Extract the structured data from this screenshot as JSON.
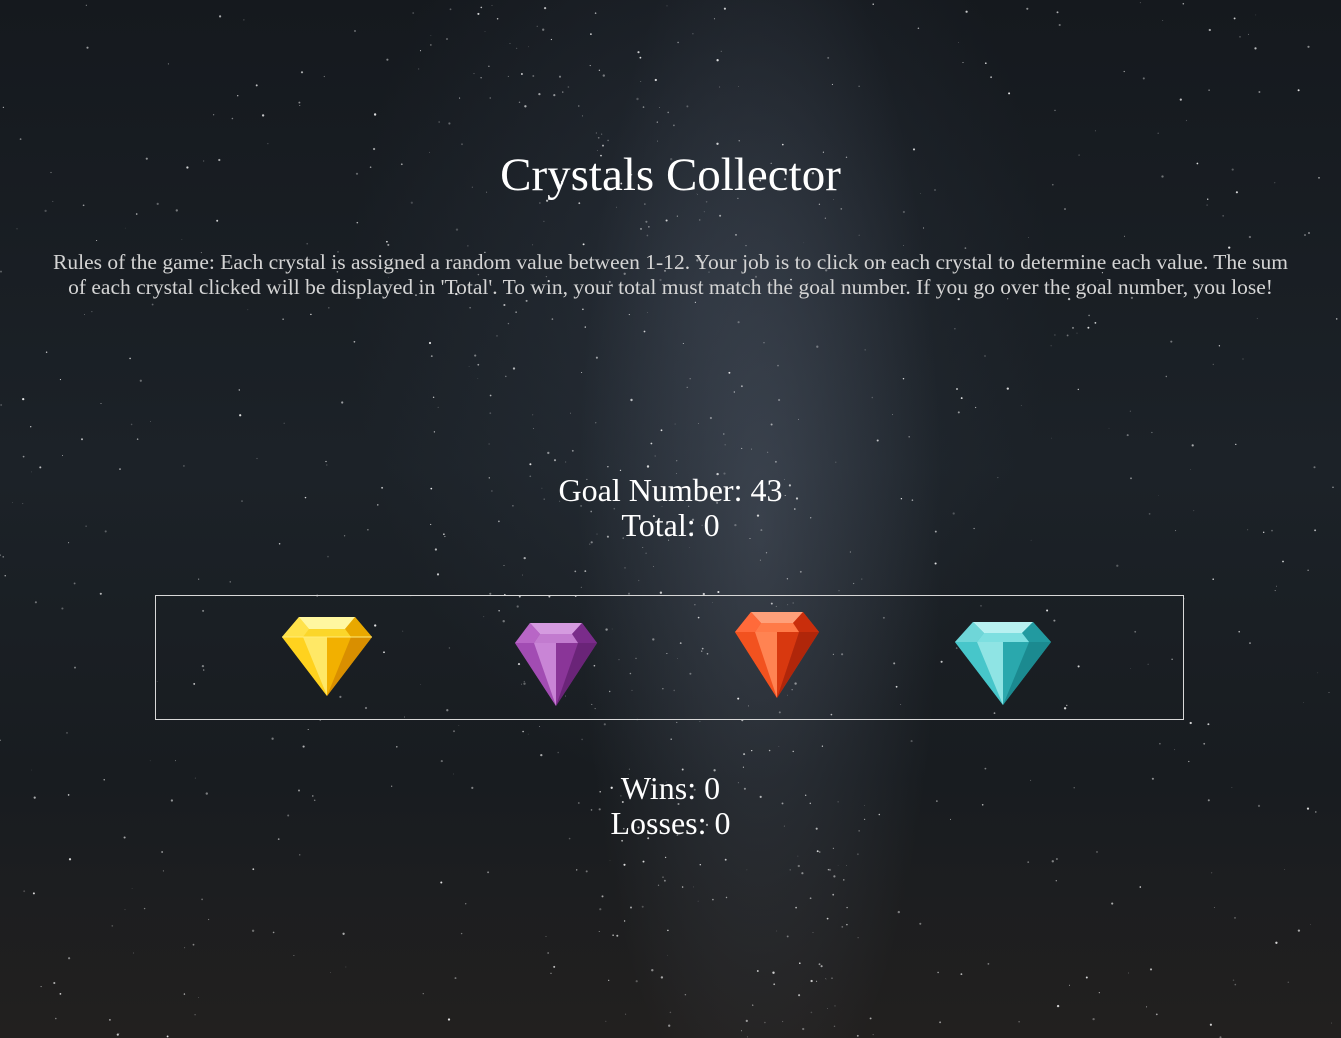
{
  "title": "Crystals Collector",
  "rules": "Rules of the game: Each crystal is assigned a random value between 1-12. Your job is to click on each crystal to determine each value. The sum of each crystal clicked will be displayed in 'Total'. To win, your total must match the goal number. If you go over the goal number, you lose!",
  "goal": {
    "label": "Goal Number: ",
    "value": "43"
  },
  "total": {
    "label": "Total: ",
    "value": "0"
  },
  "crystals": [
    {
      "icon": "yellow-crystal-icon",
      "color": "#f5c400"
    },
    {
      "icon": "purple-crystal-icon",
      "color": "#9b3fa8"
    },
    {
      "icon": "red-crystal-icon",
      "color": "#e8401a"
    },
    {
      "icon": "teal-crystal-icon",
      "color": "#34b8bd"
    }
  ],
  "wins": {
    "label": "Wins: ",
    "value": "0"
  },
  "losses": {
    "label": "Losses: ",
    "value": "0"
  }
}
